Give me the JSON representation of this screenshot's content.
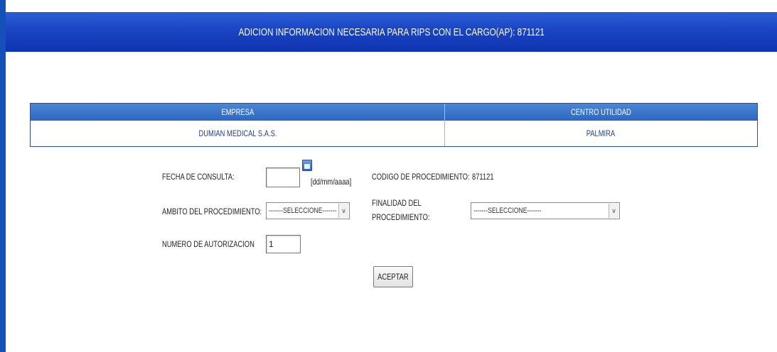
{
  "window": {
    "title": "ADICION INFORMACION NECESARIA PARA RIPS CON EL CARGO(AP): 871121"
  },
  "info_table": {
    "headers": [
      "EMPRESA",
      "CENTRO UTILIDAD"
    ],
    "row": [
      "DUMIAN MEDICAL S.A.S.",
      "PALMIRA"
    ]
  },
  "form": {
    "fecha_label": "FECHA DE CONSULTA:",
    "fecha_value": "",
    "fecha_format": "[dd/mm/aaaa]",
    "codigo_label": "CODIGO DE PROCEDIMIENTO:",
    "codigo_value": "871121",
    "ambito_label": "AMBITO DEL PROCEDIMIENTO:",
    "ambito_selected": "-------SELECCIONE-------",
    "finalidad_label_line1": "FINALIDAD DEL",
    "finalidad_label_line2": "PROCEDIMIENTO:",
    "finalidad_selected": "-------SELECCIONE-------",
    "autorizacion_label": "NUMERO DE AUTORIZACION",
    "autorizacion_value": "1",
    "submit_label": "ACEPTAR"
  },
  "colors": {
    "title_bar": "#1a44c2",
    "table_header": "#3a75cc",
    "table_text": "#1f3f8a"
  },
  "icons": {
    "calendar": "calendar-icon",
    "dropdown": "chevron-down-icon"
  }
}
